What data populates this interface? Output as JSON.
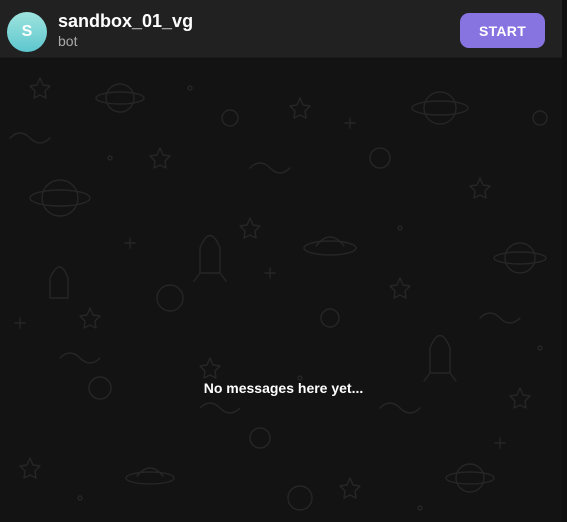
{
  "header": {
    "avatar_letter": "S",
    "title": "sandbox_01_vg",
    "subtitle": "bot",
    "start_label": "START"
  },
  "chat": {
    "empty_text": "No messages here yet..."
  },
  "colors": {
    "accent": "#8774e1",
    "header_bg": "#212121",
    "chat_bg": "#131313",
    "avatar_gradient": [
      "#9fe4dd",
      "#5dc7cf"
    ]
  }
}
